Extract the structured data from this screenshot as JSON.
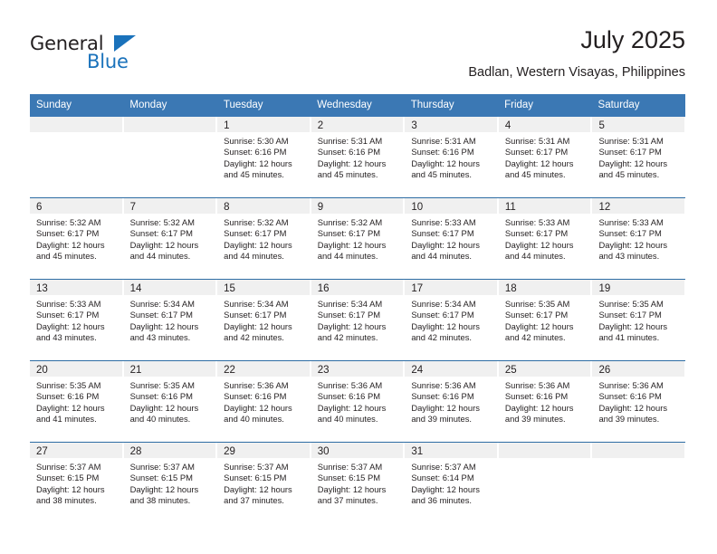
{
  "brand": {
    "name_part1": "General",
    "name_part2": "Blue",
    "triangle_color": "#1a72bb",
    "logo_icon": "blue-triangle-icon"
  },
  "header": {
    "title": "July 2025",
    "subtitle": "Badlan, Western Visayas, Philippines"
  },
  "theme": {
    "header_blue": "#3b78b4",
    "row_divider_blue": "#2e6da4",
    "daynum_band": "#f0f0f0",
    "text": "#231f20"
  },
  "weekdays": [
    "Sunday",
    "Monday",
    "Tuesday",
    "Wednesday",
    "Thursday",
    "Friday",
    "Saturday"
  ],
  "weeks": [
    [
      {
        "day": "",
        "sunrise": "",
        "sunset": "",
        "daylight1": "",
        "daylight2": ""
      },
      {
        "day": "",
        "sunrise": "",
        "sunset": "",
        "daylight1": "",
        "daylight2": ""
      },
      {
        "day": "1",
        "sunrise": "Sunrise: 5:30 AM",
        "sunset": "Sunset: 6:16 PM",
        "daylight1": "Daylight: 12 hours",
        "daylight2": "and 45 minutes."
      },
      {
        "day": "2",
        "sunrise": "Sunrise: 5:31 AM",
        "sunset": "Sunset: 6:16 PM",
        "daylight1": "Daylight: 12 hours",
        "daylight2": "and 45 minutes."
      },
      {
        "day": "3",
        "sunrise": "Sunrise: 5:31 AM",
        "sunset": "Sunset: 6:16 PM",
        "daylight1": "Daylight: 12 hours",
        "daylight2": "and 45 minutes."
      },
      {
        "day": "4",
        "sunrise": "Sunrise: 5:31 AM",
        "sunset": "Sunset: 6:17 PM",
        "daylight1": "Daylight: 12 hours",
        "daylight2": "and 45 minutes."
      },
      {
        "day": "5",
        "sunrise": "Sunrise: 5:31 AM",
        "sunset": "Sunset: 6:17 PM",
        "daylight1": "Daylight: 12 hours",
        "daylight2": "and 45 minutes."
      }
    ],
    [
      {
        "day": "6",
        "sunrise": "Sunrise: 5:32 AM",
        "sunset": "Sunset: 6:17 PM",
        "daylight1": "Daylight: 12 hours",
        "daylight2": "and 45 minutes."
      },
      {
        "day": "7",
        "sunrise": "Sunrise: 5:32 AM",
        "sunset": "Sunset: 6:17 PM",
        "daylight1": "Daylight: 12 hours",
        "daylight2": "and 44 minutes."
      },
      {
        "day": "8",
        "sunrise": "Sunrise: 5:32 AM",
        "sunset": "Sunset: 6:17 PM",
        "daylight1": "Daylight: 12 hours",
        "daylight2": "and 44 minutes."
      },
      {
        "day": "9",
        "sunrise": "Sunrise: 5:32 AM",
        "sunset": "Sunset: 6:17 PM",
        "daylight1": "Daylight: 12 hours",
        "daylight2": "and 44 minutes."
      },
      {
        "day": "10",
        "sunrise": "Sunrise: 5:33 AM",
        "sunset": "Sunset: 6:17 PM",
        "daylight1": "Daylight: 12 hours",
        "daylight2": "and 44 minutes."
      },
      {
        "day": "11",
        "sunrise": "Sunrise: 5:33 AM",
        "sunset": "Sunset: 6:17 PM",
        "daylight1": "Daylight: 12 hours",
        "daylight2": "and 44 minutes."
      },
      {
        "day": "12",
        "sunrise": "Sunrise: 5:33 AM",
        "sunset": "Sunset: 6:17 PM",
        "daylight1": "Daylight: 12 hours",
        "daylight2": "and 43 minutes."
      }
    ],
    [
      {
        "day": "13",
        "sunrise": "Sunrise: 5:33 AM",
        "sunset": "Sunset: 6:17 PM",
        "daylight1": "Daylight: 12 hours",
        "daylight2": "and 43 minutes."
      },
      {
        "day": "14",
        "sunrise": "Sunrise: 5:34 AM",
        "sunset": "Sunset: 6:17 PM",
        "daylight1": "Daylight: 12 hours",
        "daylight2": "and 43 minutes."
      },
      {
        "day": "15",
        "sunrise": "Sunrise: 5:34 AM",
        "sunset": "Sunset: 6:17 PM",
        "daylight1": "Daylight: 12 hours",
        "daylight2": "and 42 minutes."
      },
      {
        "day": "16",
        "sunrise": "Sunrise: 5:34 AM",
        "sunset": "Sunset: 6:17 PM",
        "daylight1": "Daylight: 12 hours",
        "daylight2": "and 42 minutes."
      },
      {
        "day": "17",
        "sunrise": "Sunrise: 5:34 AM",
        "sunset": "Sunset: 6:17 PM",
        "daylight1": "Daylight: 12 hours",
        "daylight2": "and 42 minutes."
      },
      {
        "day": "18",
        "sunrise": "Sunrise: 5:35 AM",
        "sunset": "Sunset: 6:17 PM",
        "daylight1": "Daylight: 12 hours",
        "daylight2": "and 42 minutes."
      },
      {
        "day": "19",
        "sunrise": "Sunrise: 5:35 AM",
        "sunset": "Sunset: 6:17 PM",
        "daylight1": "Daylight: 12 hours",
        "daylight2": "and 41 minutes."
      }
    ],
    [
      {
        "day": "20",
        "sunrise": "Sunrise: 5:35 AM",
        "sunset": "Sunset: 6:16 PM",
        "daylight1": "Daylight: 12 hours",
        "daylight2": "and 41 minutes."
      },
      {
        "day": "21",
        "sunrise": "Sunrise: 5:35 AM",
        "sunset": "Sunset: 6:16 PM",
        "daylight1": "Daylight: 12 hours",
        "daylight2": "and 40 minutes."
      },
      {
        "day": "22",
        "sunrise": "Sunrise: 5:36 AM",
        "sunset": "Sunset: 6:16 PM",
        "daylight1": "Daylight: 12 hours",
        "daylight2": "and 40 minutes."
      },
      {
        "day": "23",
        "sunrise": "Sunrise: 5:36 AM",
        "sunset": "Sunset: 6:16 PM",
        "daylight1": "Daylight: 12 hours",
        "daylight2": "and 40 minutes."
      },
      {
        "day": "24",
        "sunrise": "Sunrise: 5:36 AM",
        "sunset": "Sunset: 6:16 PM",
        "daylight1": "Daylight: 12 hours",
        "daylight2": "and 39 minutes."
      },
      {
        "day": "25",
        "sunrise": "Sunrise: 5:36 AM",
        "sunset": "Sunset: 6:16 PM",
        "daylight1": "Daylight: 12 hours",
        "daylight2": "and 39 minutes."
      },
      {
        "day": "26",
        "sunrise": "Sunrise: 5:36 AM",
        "sunset": "Sunset: 6:16 PM",
        "daylight1": "Daylight: 12 hours",
        "daylight2": "and 39 minutes."
      }
    ],
    [
      {
        "day": "27",
        "sunrise": "Sunrise: 5:37 AM",
        "sunset": "Sunset: 6:15 PM",
        "daylight1": "Daylight: 12 hours",
        "daylight2": "and 38 minutes."
      },
      {
        "day": "28",
        "sunrise": "Sunrise: 5:37 AM",
        "sunset": "Sunset: 6:15 PM",
        "daylight1": "Daylight: 12 hours",
        "daylight2": "and 38 minutes."
      },
      {
        "day": "29",
        "sunrise": "Sunrise: 5:37 AM",
        "sunset": "Sunset: 6:15 PM",
        "daylight1": "Daylight: 12 hours",
        "daylight2": "and 37 minutes."
      },
      {
        "day": "30",
        "sunrise": "Sunrise: 5:37 AM",
        "sunset": "Sunset: 6:15 PM",
        "daylight1": "Daylight: 12 hours",
        "daylight2": "and 37 minutes."
      },
      {
        "day": "31",
        "sunrise": "Sunrise: 5:37 AM",
        "sunset": "Sunset: 6:14 PM",
        "daylight1": "Daylight: 12 hours",
        "daylight2": "and 36 minutes."
      },
      {
        "day": "",
        "sunrise": "",
        "sunset": "",
        "daylight1": "",
        "daylight2": ""
      },
      {
        "day": "",
        "sunrise": "",
        "sunset": "",
        "daylight1": "",
        "daylight2": ""
      }
    ]
  ]
}
